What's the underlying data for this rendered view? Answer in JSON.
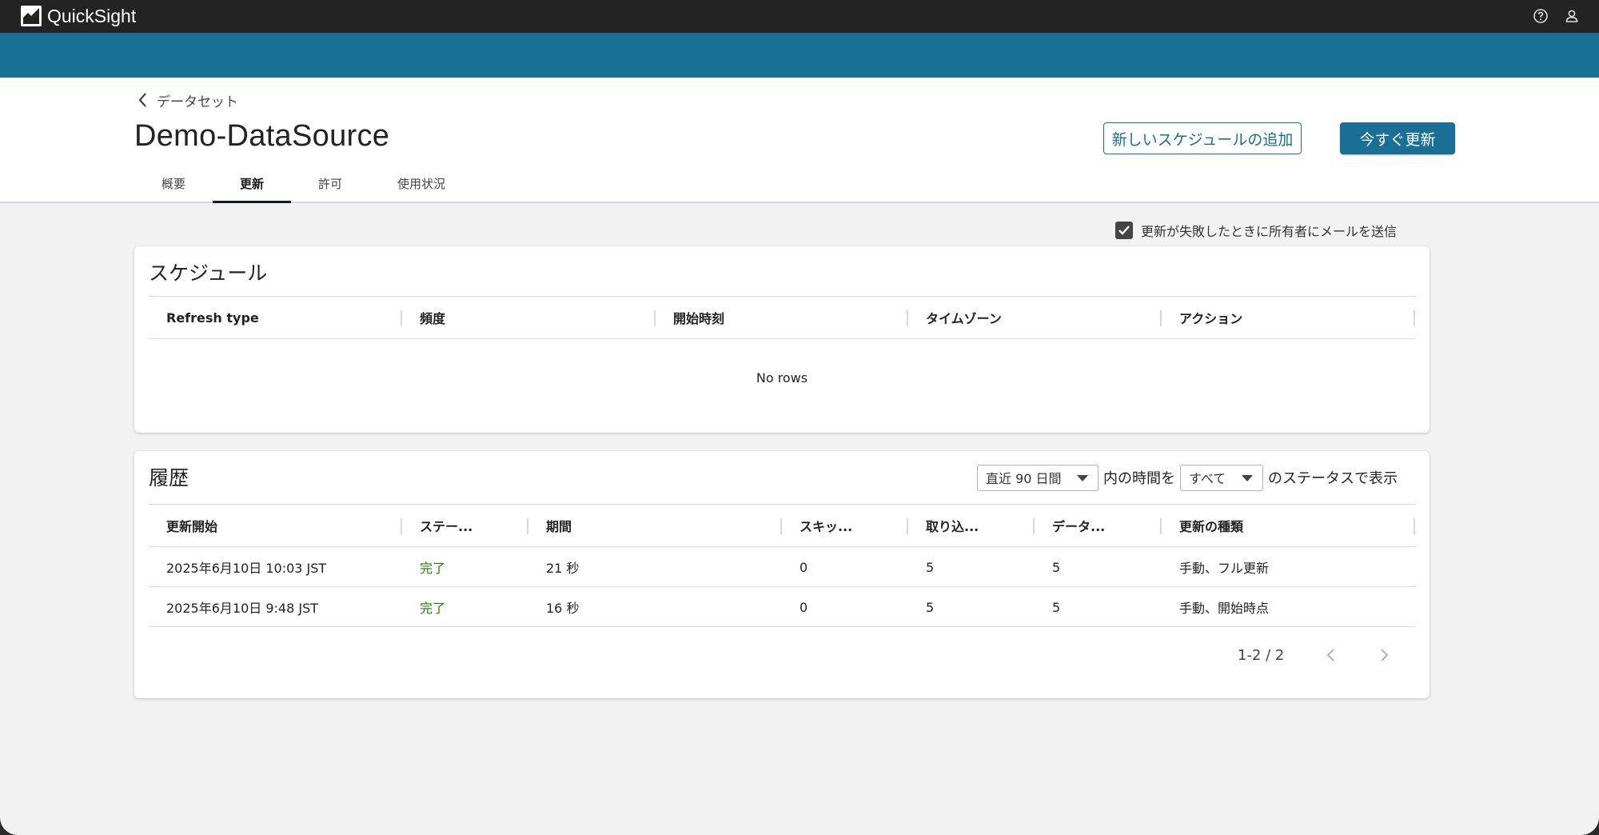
{
  "app": {
    "brand": "QuickSight"
  },
  "breadcrumb": {
    "label": "データセット"
  },
  "page": {
    "title": "Demo-DataSource"
  },
  "buttons": {
    "add_schedule": "新しいスケジュールの追加",
    "refresh_now": "今すぐ更新"
  },
  "tabs": [
    {
      "label": "概要",
      "active": false
    },
    {
      "label": "更新",
      "active": true
    },
    {
      "label": "許可",
      "active": false
    },
    {
      "label": "使用状況",
      "active": false
    }
  ],
  "notify": {
    "label": "更新が失敗したときに所有者にメールを送信",
    "checked": true
  },
  "schedule": {
    "title": "スケジュール",
    "columns": [
      "Refresh type",
      "頻度",
      "開始時刻",
      "タイムゾーン",
      "アクション"
    ],
    "empty_text": "No rows"
  },
  "history": {
    "title": "履歴",
    "filter": {
      "range": "直近 90 日間",
      "text_mid": "内の時間を",
      "status": "すべて",
      "text_end": "のステータスで表示"
    },
    "columns": [
      "更新開始",
      "ステー...",
      "期間",
      "スキッ...",
      "取り込...",
      "データ...",
      "更新の種類"
    ],
    "rows": [
      [
        "2025年6月10日 10:03 JST",
        "完了",
        "21 秒",
        "0",
        "5",
        "5",
        "手動、フル更新"
      ],
      [
        "2025年6月10日 9:48 JST",
        "完了",
        "16 秒",
        "0",
        "5",
        "5",
        "手動、開始時点"
      ]
    ],
    "pagination": "1-2 / 2"
  },
  "colors": {
    "accent": "#1a6f97",
    "success": "#1d8102",
    "topbar": "#232323"
  }
}
